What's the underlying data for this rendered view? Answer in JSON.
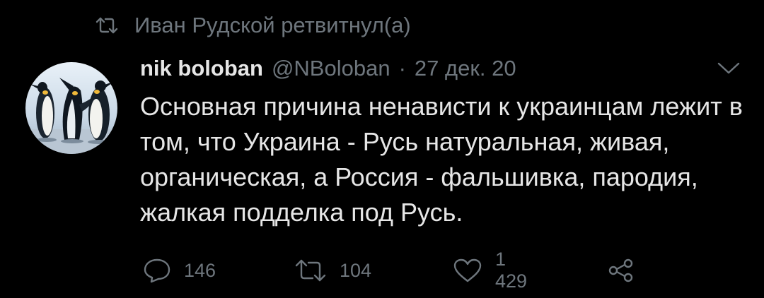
{
  "retweet": {
    "text": "Иван Рудской ретвитнул(а)"
  },
  "tweet": {
    "author_name": "nik boloban",
    "author_handle": "@NBoloban",
    "separator": "·",
    "date": "27 дек. 20",
    "text": "Основная причина ненависти к украинцам лежит в том, что Украина - Русь натуральная, живая, органическая, а Россия - фальшивка, пародия, жалкая подделка под Русь."
  },
  "actions": {
    "replies": "146",
    "retweets": "104",
    "likes": "1 429"
  },
  "icons": {
    "retweet_header": "retweet-icon",
    "avatar": "penguins-avatar",
    "menu": "chevron-down-icon",
    "reply": "reply-icon",
    "retweet": "retweet-icon",
    "like": "heart-icon",
    "share": "share-icon"
  },
  "colors": {
    "background": "#000000",
    "text": "#e6e6e6",
    "muted": "#6e767d"
  }
}
